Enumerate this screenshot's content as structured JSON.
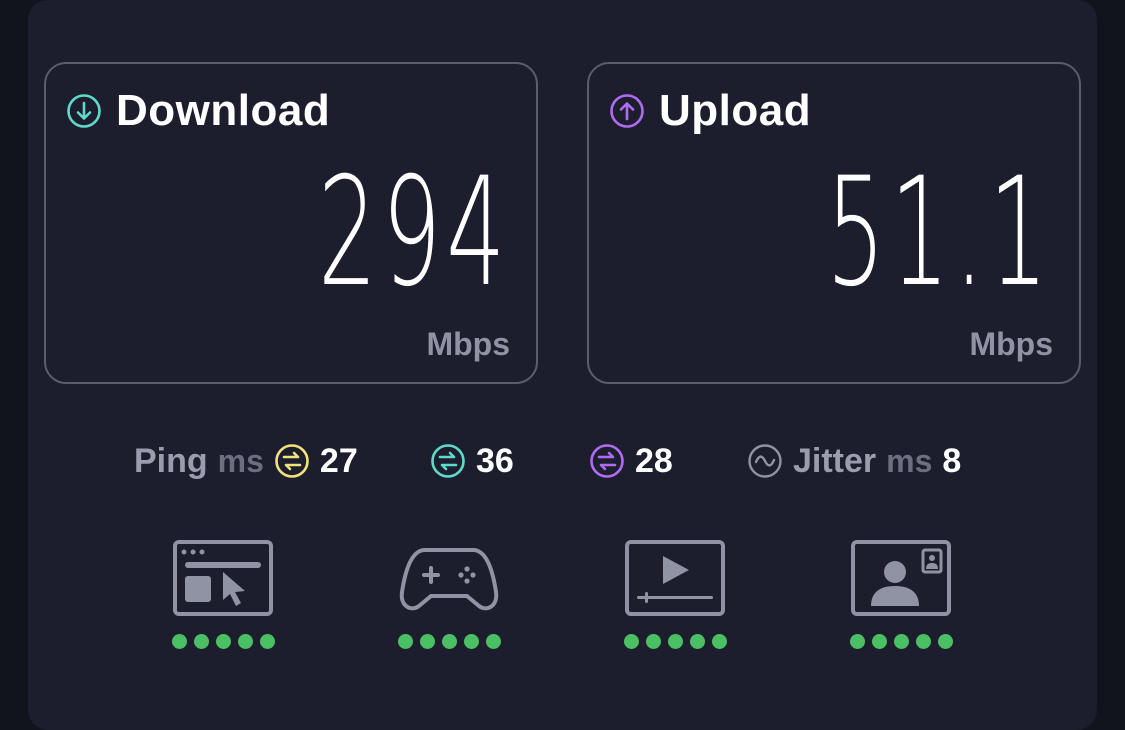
{
  "download": {
    "title": "Download",
    "value": "294",
    "unit": "Mbps",
    "icon": "arrow-down-circle-icon",
    "accent": "#5fd9cc"
  },
  "upload": {
    "title": "Upload",
    "value": "51.1",
    "unit": "Mbps",
    "icon": "arrow-up-circle-icon",
    "accent": "#b06cf0"
  },
  "ping": {
    "label": "Ping",
    "unit": "ms",
    "unloaded": {
      "value": "27",
      "icon": "ping-unloaded-icon",
      "color": "#f3e27a"
    },
    "download": {
      "value": "36",
      "icon": "ping-download-icon",
      "color": "#5fd9cc"
    },
    "upload": {
      "value": "28",
      "icon": "ping-upload-icon",
      "color": "#b06cf0"
    }
  },
  "jitter": {
    "label": "Jitter",
    "unit": "ms",
    "value": "8",
    "icon": "jitter-wave-icon"
  },
  "use_cases": [
    {
      "icon": "web-browsing-icon",
      "rating": 5
    },
    {
      "icon": "gaming-controller-icon",
      "rating": 5
    },
    {
      "icon": "video-streaming-icon",
      "rating": 5
    },
    {
      "icon": "video-call-icon",
      "rating": 5
    }
  ],
  "colors": {
    "background": "#1c1e2d",
    "card_border": "#5a5d6e",
    "rating_dot": "#4bbf63",
    "icon_gray": "#8f93a3"
  }
}
